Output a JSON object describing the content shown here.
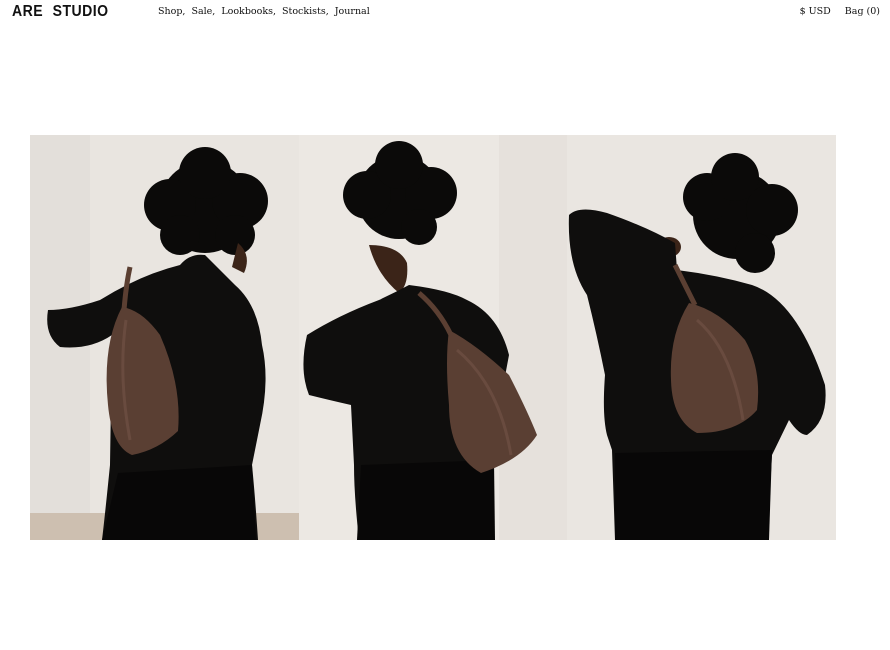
{
  "brand": {
    "name": "ARE STUDIO"
  },
  "nav": {
    "items": [
      {
        "label": "Shop,"
      },
      {
        "label": "Sale,"
      },
      {
        "label": "Lookbooks,"
      },
      {
        "label": "Stockists,"
      },
      {
        "label": "Journal"
      }
    ]
  },
  "utility": {
    "currency": "$ USD",
    "bag": "Bag (0)"
  },
  "hero": {
    "description": "Three-panel lookbook image of a model in black clothing wearing a brown leather bag",
    "colors": {
      "backdrop": "#e8e4df",
      "floor": "#c9b9a8",
      "clothing": "#0e0d0c",
      "hair": "#0a0908",
      "skin": "#3b2418",
      "bag": "#5a3f33"
    }
  }
}
